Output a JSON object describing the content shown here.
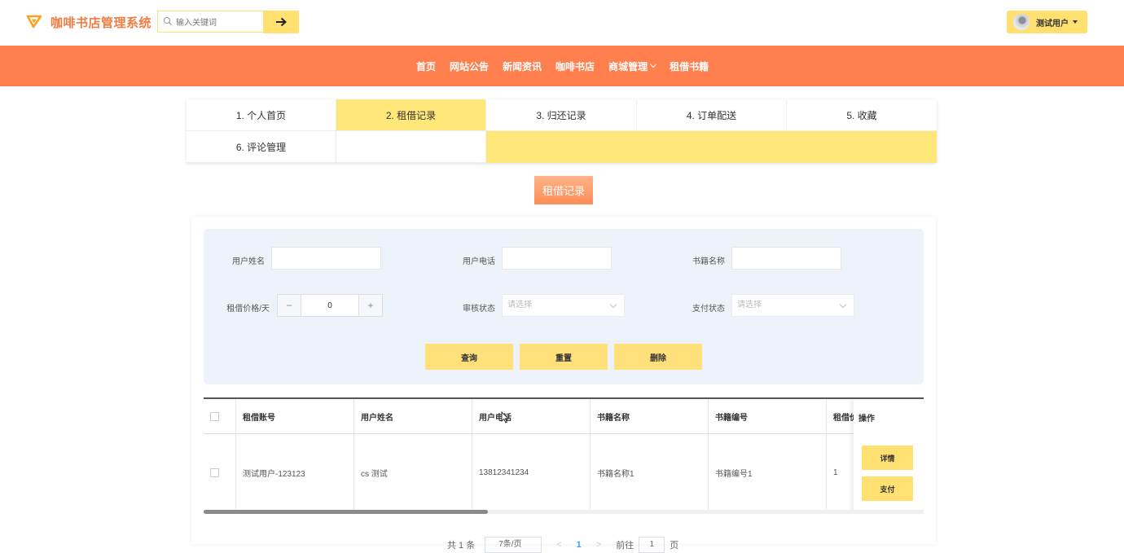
{
  "header": {
    "app_title": "咖啡书店管理系统",
    "search_placeholder": "输入关键词",
    "user_name": "测试用户",
    "accent": "#ff7f4f",
    "brand_yellow": "#ffe070"
  },
  "nav": {
    "items": [
      {
        "label": "首页"
      },
      {
        "label": "网站公告"
      },
      {
        "label": "新闻资讯"
      },
      {
        "label": "咖啡书店"
      },
      {
        "label": "商城管理",
        "has_dropdown": true
      },
      {
        "label": "租借书籍"
      }
    ]
  },
  "tabs": [
    {
      "label": "1. 个人首页",
      "active": false
    },
    {
      "label": "2. 租借记录",
      "active": true
    },
    {
      "label": "3. 归还记录",
      "active": false
    },
    {
      "label": "4. 订单配送",
      "active": false
    },
    {
      "label": "5. 收藏",
      "active": false
    },
    {
      "label": "6. 评论管理",
      "active": false
    }
  ],
  "section_title": "租借记录",
  "filters": {
    "user_name_label": "用户姓名",
    "user_phone_label": "用户电话",
    "book_name_label": "书籍名称",
    "price_label": "租借价格/天",
    "price_value": "0",
    "audit_label": "审核状态",
    "audit_placeholder": "请选择",
    "pay_label": "支付状态",
    "pay_placeholder": "请选择",
    "stepper_minus": "−",
    "stepper_plus": "+"
  },
  "buttons": {
    "query": "查询",
    "reset": "重置",
    "delete": "删除"
  },
  "table": {
    "columns": [
      "租借账号",
      "用户姓名",
      "用户电话",
      "书籍名称",
      "书籍编号",
      "租借价"
    ],
    "ops_header": "操作",
    "rows": [
      {
        "account": "测试用户-123123",
        "name": "cs 测试",
        "phone": "13812341234",
        "book_name": "书籍名称1",
        "book_no": "书籍编号1",
        "price": "1",
        "detail_label": "详情",
        "pay_label": "支付"
      }
    ]
  },
  "pagination": {
    "total": "共 1 条",
    "page_size": "7条/页",
    "prev": "<",
    "current": "1",
    "next": ">",
    "goto": "前往",
    "goto_value": "1",
    "unit": "页"
  }
}
